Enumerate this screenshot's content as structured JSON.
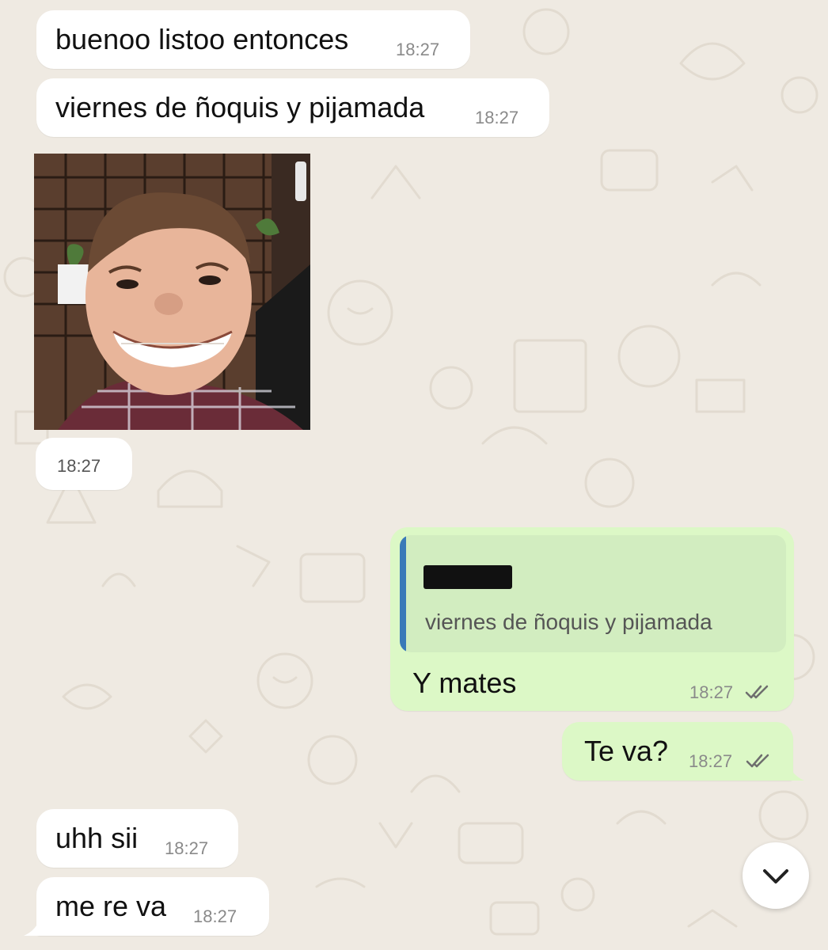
{
  "chat": {
    "messages": [
      {
        "id": "m1",
        "direction": "incoming",
        "type": "text",
        "text": "buenoo listoo entonces",
        "time": "18:27"
      },
      {
        "id": "m2",
        "direction": "incoming",
        "type": "text",
        "text": "viernes de ñoquis y pijamada",
        "time": "18:27"
      },
      {
        "id": "m3",
        "direction": "incoming",
        "type": "image",
        "image": "photo of a grinning child",
        "time": "18:27"
      },
      {
        "id": "m4",
        "direction": "outgoing",
        "type": "reply",
        "quoted_text": "viernes de ñoquis y pijamada",
        "text": "Y mates",
        "time": "18:27",
        "status": "read"
      },
      {
        "id": "m5",
        "direction": "outgoing",
        "type": "text",
        "text": "Te va?",
        "time": "18:27",
        "status": "read"
      },
      {
        "id": "m6",
        "direction": "incoming",
        "type": "text",
        "text": "uhh sii",
        "time": "18:27"
      },
      {
        "id": "m7",
        "direction": "incoming",
        "type": "text",
        "text": "me re va",
        "time": "18:27"
      }
    ]
  },
  "scroll_button": {
    "icon": "chevron-down-icon"
  },
  "colors": {
    "background": "#efeae2",
    "incoming_bubble": "#ffffff",
    "outgoing_bubble": "#dcf8c6",
    "quote_bar": "#3a7ab8",
    "quote_background": "#d2edc0",
    "timestamp": "#8a8a8a"
  }
}
